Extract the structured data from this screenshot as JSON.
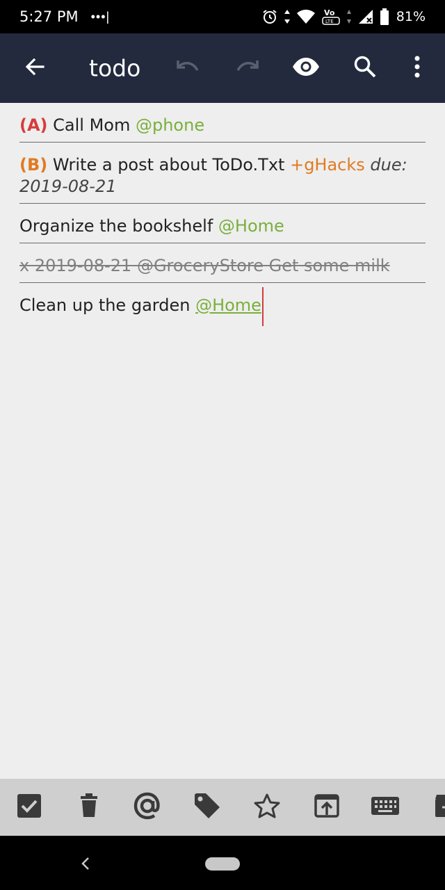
{
  "status_bar": {
    "time": "5:27 PM",
    "dots": "•••|",
    "battery_percent": "81%",
    "icons": [
      "alarm-icon",
      "data-arrows-icon",
      "wifi-icon",
      "volte-icon",
      "signal-icon",
      "battery-icon"
    ]
  },
  "app_bar": {
    "title": "todo",
    "icons": [
      "back-arrow-icon",
      "undo-icon",
      "redo-icon",
      "eye-icon",
      "search-icon",
      "more-vert-icon"
    ]
  },
  "todos": [
    {
      "priority": "(A)",
      "text": " Call Mom ",
      "context": "@phone"
    },
    {
      "priority": "(B)",
      "text": " Write a post about ToDo.Txt ",
      "project": "+gHacks",
      "due_label": " due:",
      "due_date": "2019-08-21"
    },
    {
      "text": "Organize the bookshelf ",
      "context": "@Home"
    },
    {
      "text": "x 2019-08-21 @GroceryStore Get some milk"
    },
    {
      "text": "Clean up the garden ",
      "context": "@Home"
    }
  ],
  "toolbar": {
    "icons": [
      "checkbox-icon",
      "trash-icon",
      "at-icon",
      "tag-icon",
      "star-icon",
      "open-in-icon",
      "keyboard-icon",
      "archive-icon"
    ]
  },
  "colors": {
    "app_bar": "#232a3d",
    "priority_a": "#d73c3c",
    "priority_b": "#e07b22",
    "context": "#7aaf3c",
    "project": "#e07b22",
    "caret": "#d23c3c"
  }
}
